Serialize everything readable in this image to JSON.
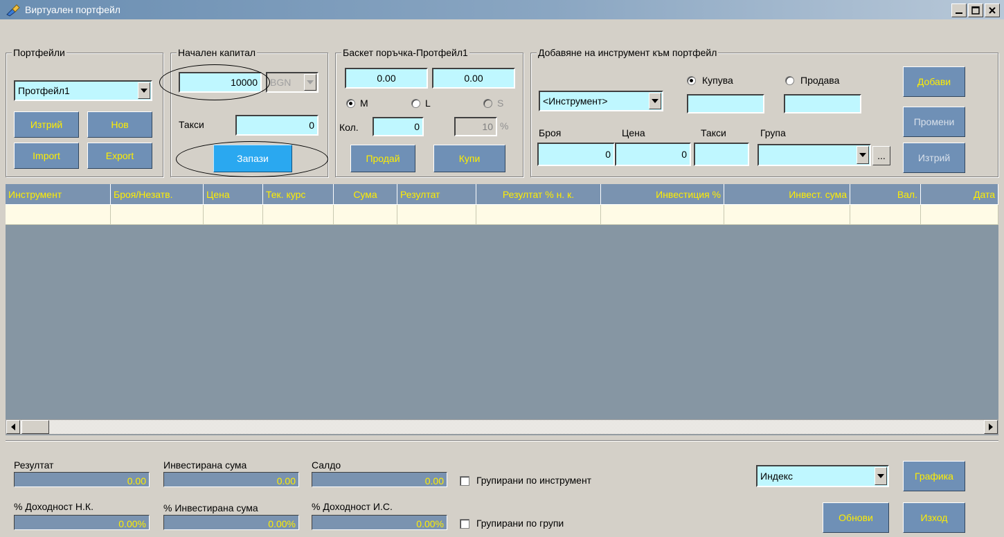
{
  "window": {
    "title": "Виртуален портфейл"
  },
  "portfolios": {
    "label": "Портфейли",
    "selected": "Протфейл1",
    "delete_label": "Изтрий",
    "new_label": "Нов",
    "import_label": "Import",
    "export_label": "Export"
  },
  "capital": {
    "label": "Начален капитал",
    "amount": "10000",
    "currency": "BGN",
    "fees_label": "Такси",
    "fees_value": "0",
    "save_label": "Запази"
  },
  "basket": {
    "label": "Баскет поръчка-Протфейл1",
    "value1": "0.00",
    "value2": "0.00",
    "radio_m": "M",
    "radio_l": "L",
    "radio_s": "S",
    "qty_label": "Кол.",
    "qty_value": "0",
    "pct_value": "10",
    "pct_unit": "%",
    "sell_label": "Продай",
    "buy_label": "Купи"
  },
  "add_instrument": {
    "label": "Добавяне на инструмент към портфейл",
    "instrument": "<Инструмент>",
    "buy_radio": "Купува",
    "sell_radio": "Продава",
    "count_label": "Броя",
    "price_label": "Цена",
    "fees_label": "Такси",
    "group_label": "Група",
    "count_value": "0",
    "price_value": "0",
    "ellipsis": "...",
    "add_label": "Добави",
    "change_label": "Промени",
    "delete_label": "Изтрий"
  },
  "table": {
    "columns": [
      "Инструмент",
      "Броя/Незатв.",
      "Цена",
      "Тек. курс",
      "Сума",
      "Резултат",
      "Резултат % н. к.",
      "Инвестиция %",
      "Инвест. сума",
      "Вал.",
      "Дата"
    ]
  },
  "summary": {
    "result_label": "Резултат",
    "result_value": "0.00",
    "invested_label": "Инвестирана сума",
    "invested_value": "0.00",
    "balance_label": "Салдо",
    "balance_value": "0.00",
    "yield_nk_label": "% Доходност Н.К.",
    "yield_nk_value": "0.00%",
    "invested_pct_label": "% Инвестирана сума",
    "invested_pct_value": "0.00%",
    "yield_is_label": "% Доходност И.С.",
    "yield_is_value": "0.00%",
    "group_by_instrument": "Групирани по инструмент",
    "group_by_groups": "Групирани по групи",
    "index_selected": "Индекс",
    "chart_label": "Графика",
    "refresh_label": "Обнови",
    "exit_label": "Изход"
  }
}
